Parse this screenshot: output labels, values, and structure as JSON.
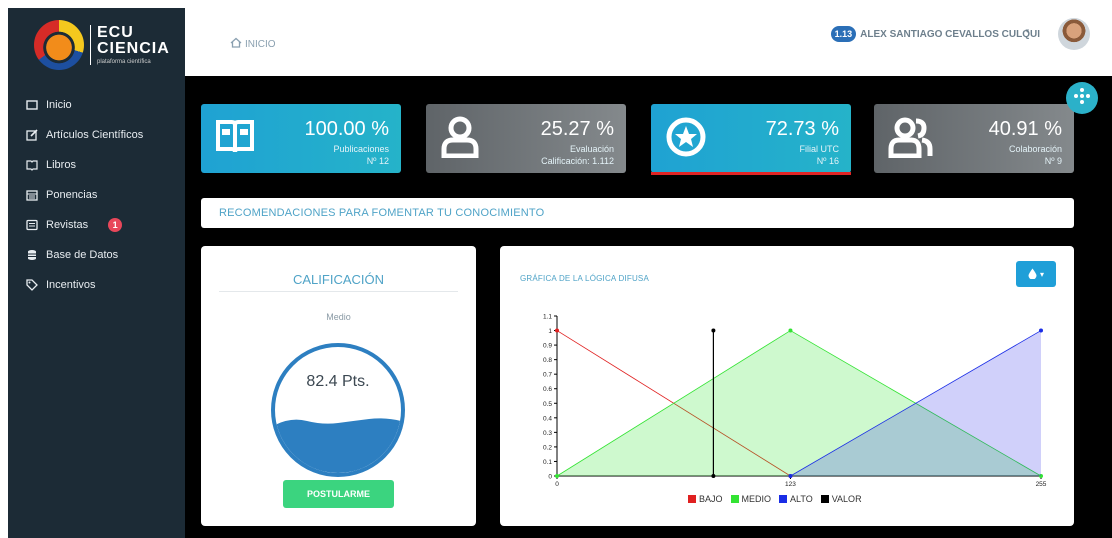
{
  "brand": {
    "line1": "ECU",
    "line2": "CIENCIA",
    "tagline": "plataforma científica"
  },
  "sidebar": {
    "items": [
      {
        "label": "Inicio",
        "icon": "window-icon"
      },
      {
        "label": "Artículos Científicos",
        "icon": "edit-icon"
      },
      {
        "label": "Libros",
        "icon": "book-icon"
      },
      {
        "label": "Ponencias",
        "icon": "calendar-icon"
      },
      {
        "label": "Revistas",
        "icon": "news-icon",
        "badge": "1"
      },
      {
        "label": "Base de Datos",
        "icon": "database-icon"
      },
      {
        "label": "Incentivos",
        "icon": "tag-icon"
      }
    ]
  },
  "header": {
    "breadcrumb": "INICIO",
    "user_badge": "1.13",
    "user_name": "ALEX SANTIAGO CEVALLOS CULQUI"
  },
  "stats": [
    {
      "percent": "100.00 %",
      "label": "Publicaciones",
      "detail": "Nº 12",
      "icon": "open-book-icon"
    },
    {
      "percent": "25.27 %",
      "label": "Evaluación",
      "detail": "Calificación: 1.112",
      "icon": "user-icon"
    },
    {
      "percent": "72.73 %",
      "label": "Filial UTC",
      "detail": "Nº 16",
      "icon": "star-icon"
    },
    {
      "percent": "40.91 %",
      "label": "Colaboración",
      "detail": "Nº 9",
      "icon": "users-icon"
    }
  ],
  "recommendations_banner": "RECOMENDACIONES PARA FOMENTAR TU CONOCIMIENTO",
  "rating_card": {
    "title": "CALIFICACIÓN",
    "level": "Medio",
    "points": "82.4 Pts.",
    "fill_fraction": 0.33,
    "button": "POSTULARME"
  },
  "chart_card": {
    "title": "GRÁFICA DE LA LÓGICA DIFUSA"
  },
  "colors": {
    "teal": "#1fa2d3",
    "grey": "#6f7477",
    "bajo": "#e02020",
    "medio": "#33e333",
    "alto": "#1a2de6",
    "valor": "#000000"
  },
  "chart_data": {
    "type": "area",
    "title": "GRÁFICA DE LA LÓGICA DIFUSA",
    "xlim": [
      0,
      255
    ],
    "ylim": [
      0,
      1.1
    ],
    "yticks": [
      "0",
      "0.1",
      "0.2",
      "0.3",
      "0.4",
      "0.5",
      "0.6",
      "0.7",
      "0.8",
      "0.9",
      "1",
      "1.1"
    ],
    "xticks": [
      "0",
      "123",
      "255"
    ],
    "series": [
      {
        "name": "BAJO",
        "color": "#e02020",
        "points": [
          [
            0,
            1
          ],
          [
            123,
            0
          ]
        ]
      },
      {
        "name": "MEDIO",
        "color": "#33e333",
        "points": [
          [
            0,
            0
          ],
          [
            123,
            1
          ],
          [
            255,
            0
          ]
        ]
      },
      {
        "name": "ALTO",
        "color": "#1a2de6",
        "points": [
          [
            123,
            0
          ],
          [
            255,
            1
          ]
        ]
      },
      {
        "name": "VALOR",
        "color": "#000000",
        "points": [
          [
            82.4,
            0
          ],
          [
            82.4,
            1
          ]
        ]
      }
    ]
  }
}
